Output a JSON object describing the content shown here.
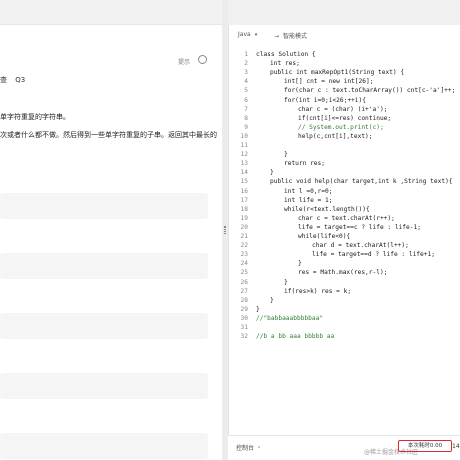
{
  "problem": {
    "hint_link": "提示",
    "meta": [
      "查",
      "Q3"
    ],
    "description_lines": [
      "单字符重复的字符串。",
      "次或者什么都不做。然后得到一些单字符重复的子串。返回其中最长的"
    ]
  },
  "editor": {
    "language": "Java",
    "mode_label": "智能模式",
    "lines": [
      {
        "num": "1",
        "text": "class Solution {",
        "indent": 0
      },
      {
        "num": "2",
        "text": "int res;",
        "indent": 1
      },
      {
        "num": "3",
        "text": "public int maxRepOpt1(String text) {",
        "indent": 1
      },
      {
        "num": "4",
        "text": "int[] cnt = new int[26];",
        "indent": 2
      },
      {
        "num": "5",
        "text": "for(char c : text.toCharArray()) cnt[c-'a']++;",
        "indent": 2
      },
      {
        "num": "6",
        "text": "for(int i=0;i<26;++i){",
        "indent": 2
      },
      {
        "num": "7",
        "text": "char c = (char) (i+'a');",
        "indent": 3
      },
      {
        "num": "8",
        "text": "if(cnt[i]<=res) continue;",
        "indent": 3
      },
      {
        "num": "9",
        "text": "// System.out.print(c);",
        "indent": 3
      },
      {
        "num": "10",
        "text": "help(c,cnt[i],text);",
        "indent": 3
      },
      {
        "num": "11",
        "text": "",
        "indent": 0
      },
      {
        "num": "12",
        "text": "}",
        "indent": 2
      },
      {
        "num": "13",
        "text": "return res;",
        "indent": 2
      },
      {
        "num": "14",
        "text": "}",
        "indent": 1
      },
      {
        "num": "15",
        "text": "public void help(char target,int k ,String text){",
        "indent": 1
      },
      {
        "num": "16",
        "text": "int l =0,r=0;",
        "indent": 2
      },
      {
        "num": "17",
        "text": "int life = 1;",
        "indent": 2
      },
      {
        "num": "18",
        "text": "while(r<text.length()){",
        "indent": 2
      },
      {
        "num": "19",
        "text": "char c = text.charAt(r++);",
        "indent": 3
      },
      {
        "num": "20",
        "text": "life = target==c ? life : life-1;",
        "indent": 3
      },
      {
        "num": "21",
        "text": "while(life<0){",
        "indent": 3
      },
      {
        "num": "22",
        "text": "char d = text.charAt(l++);",
        "indent": 4
      },
      {
        "num": "23",
        "text": "life = target==d ? life : life+1;",
        "indent": 4
      },
      {
        "num": "24",
        "text": "}",
        "indent": 3
      },
      {
        "num": "25",
        "text": "res = Math.max(res,r-l);",
        "indent": 3
      },
      {
        "num": "26",
        "text": "}",
        "indent": 2
      },
      {
        "num": "27",
        "text": "if(res>k) res = k;",
        "indent": 2
      },
      {
        "num": "28",
        "text": "}",
        "indent": 1
      },
      {
        "num": "29",
        "text": "}",
        "indent": 0
      },
      {
        "num": "30",
        "text": "//\"babbaaabbbbbaa\"",
        "indent": 0
      },
      {
        "num": "31",
        "text": "",
        "indent": 0
      },
      {
        "num": "32",
        "text": "//b a bb aaa bbbbb aa",
        "indent": 0
      }
    ]
  },
  "bottom": {
    "console_label": "控制台",
    "watermark": "@稀土掘金技术社区",
    "result_label": "本次耗时0.00",
    "result_time": "14"
  }
}
